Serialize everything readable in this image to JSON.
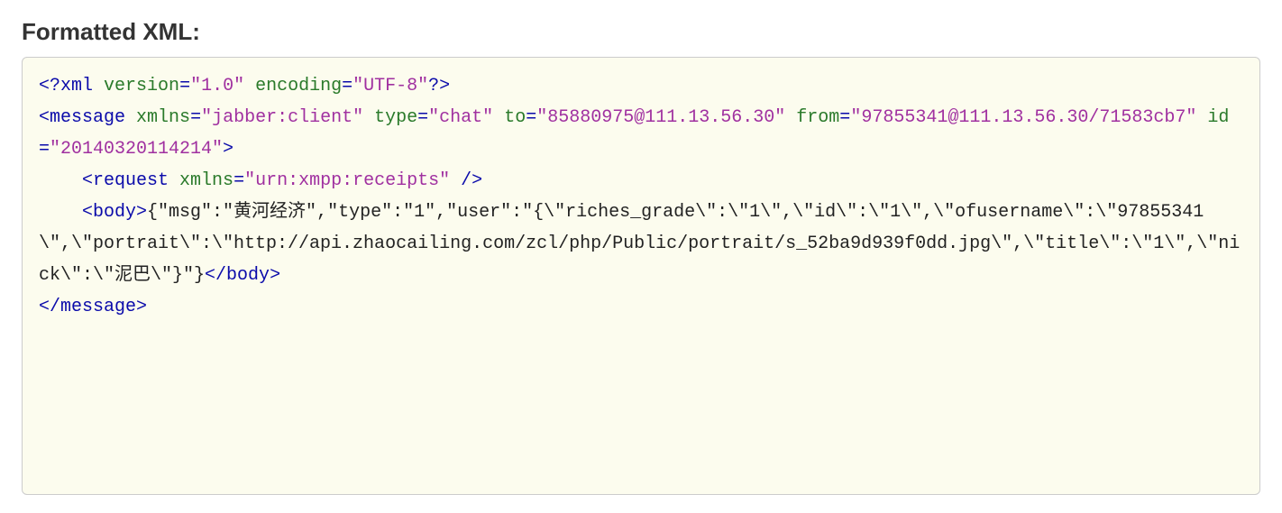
{
  "heading": "Formatted XML:",
  "xml": {
    "decl": {
      "version_attr": "version",
      "version_val": "\"1.0\"",
      "encoding_attr": "encoding",
      "encoding_val": "\"UTF-8\""
    },
    "message": {
      "tag": "message",
      "xmlns_attr": "xmlns",
      "xmlns_val": "\"jabber:client\"",
      "type_attr": "type",
      "type_val": "\"chat\"",
      "to_attr": "to",
      "to_val": "\"85880975@111.13.56.30\"",
      "from_attr": "from",
      "from_val": "\"97855341@111.13.56.30/71583cb7\"",
      "id_attr": "id",
      "id_val": "\"20140320114214\""
    },
    "request": {
      "tag": "request",
      "xmlns_attr": "xmlns",
      "xmlns_val": "\"urn:xmpp:receipts\""
    },
    "body": {
      "tag": "body",
      "content": "{\"msg\":\"黄河经济\",\"type\":\"1\",\"user\":\"{\\\"riches_grade\\\":\\\"1\\\",\\\"id\\\":\\\"1\\\",\\\"ofusername\\\":\\\"97855341\\\",\\\"portrait\\\":\\\"http://api.zhaocailing.com/zcl/php/Public/portrait/s_52ba9d939f0dd.jpg\\\",\\\"title\\\":\\\"1\\\",\\\"nick\\\":\\\"泥巴\\\"}\"}"
    }
  }
}
